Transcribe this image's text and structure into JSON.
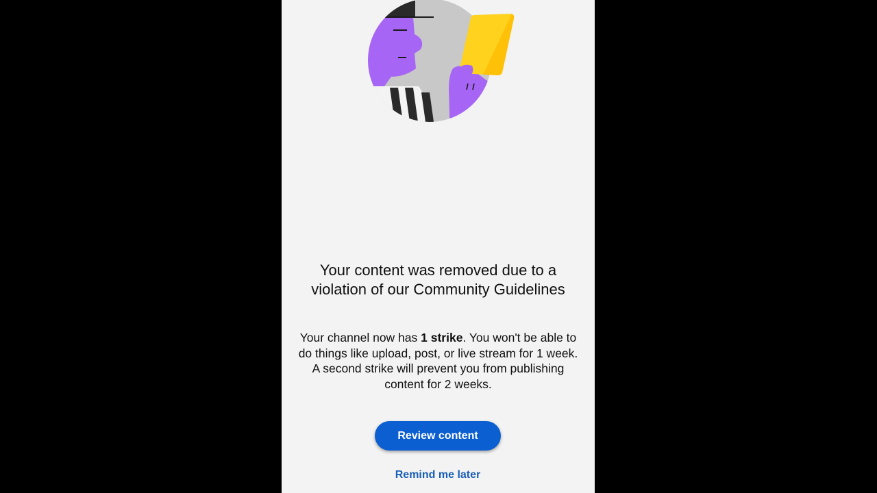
{
  "colors": {
    "outer_background": "#000000",
    "screen_background": "#f3f3f3",
    "primary_button": "#0b5fd0",
    "link": "#1a5fb4",
    "illustration_purple": "#a665f5",
    "illustration_gray": "#c8c8c8",
    "illustration_yellow": "#ffd21e",
    "illustration_dark": "#2a2a2a"
  },
  "illustration": {
    "name": "referee-yellow-card-illustration"
  },
  "dialog": {
    "title": "Your content was removed due to a violation of our Community Guidelines",
    "body_prefix": "Your channel now has ",
    "body_bold": "1 strike",
    "body_suffix": ". You won't be able to do things like upload, post, or live stream for 1 week. A second strike will prevent you from publishing content for 2 weeks.",
    "primary_button_label": "Review content",
    "secondary_link_label": "Remind me later"
  }
}
